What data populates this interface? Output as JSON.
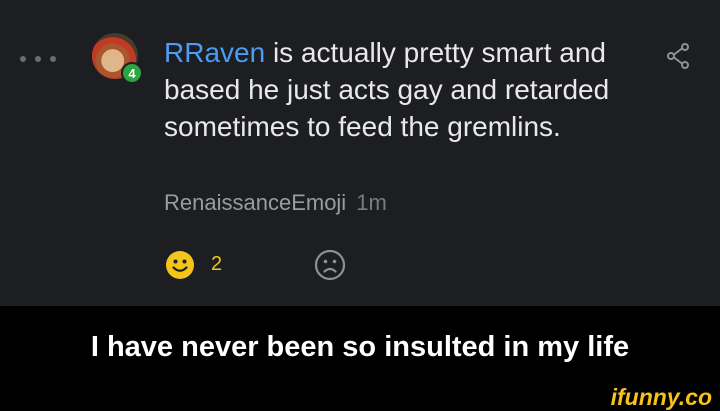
{
  "comment": {
    "mention": "RRaven",
    "text": " is actually pretty smart and based he just acts gay and retarded sometimes to feed the gremlins.",
    "author": "RenaissanceEmoji",
    "time": "1m",
    "level": "4",
    "smile_count": "2"
  },
  "caption": "I have never been so insulted in my life",
  "watermark": "ifunny.co",
  "colors": {
    "panel_bg": "#1d1e22",
    "mention": "#4a9cf5",
    "smile": "#f3c41a",
    "badge": "#2fa444"
  },
  "icons": [
    "more-dots-icon",
    "share-icon",
    "smile-icon",
    "sad-face-icon"
  ]
}
